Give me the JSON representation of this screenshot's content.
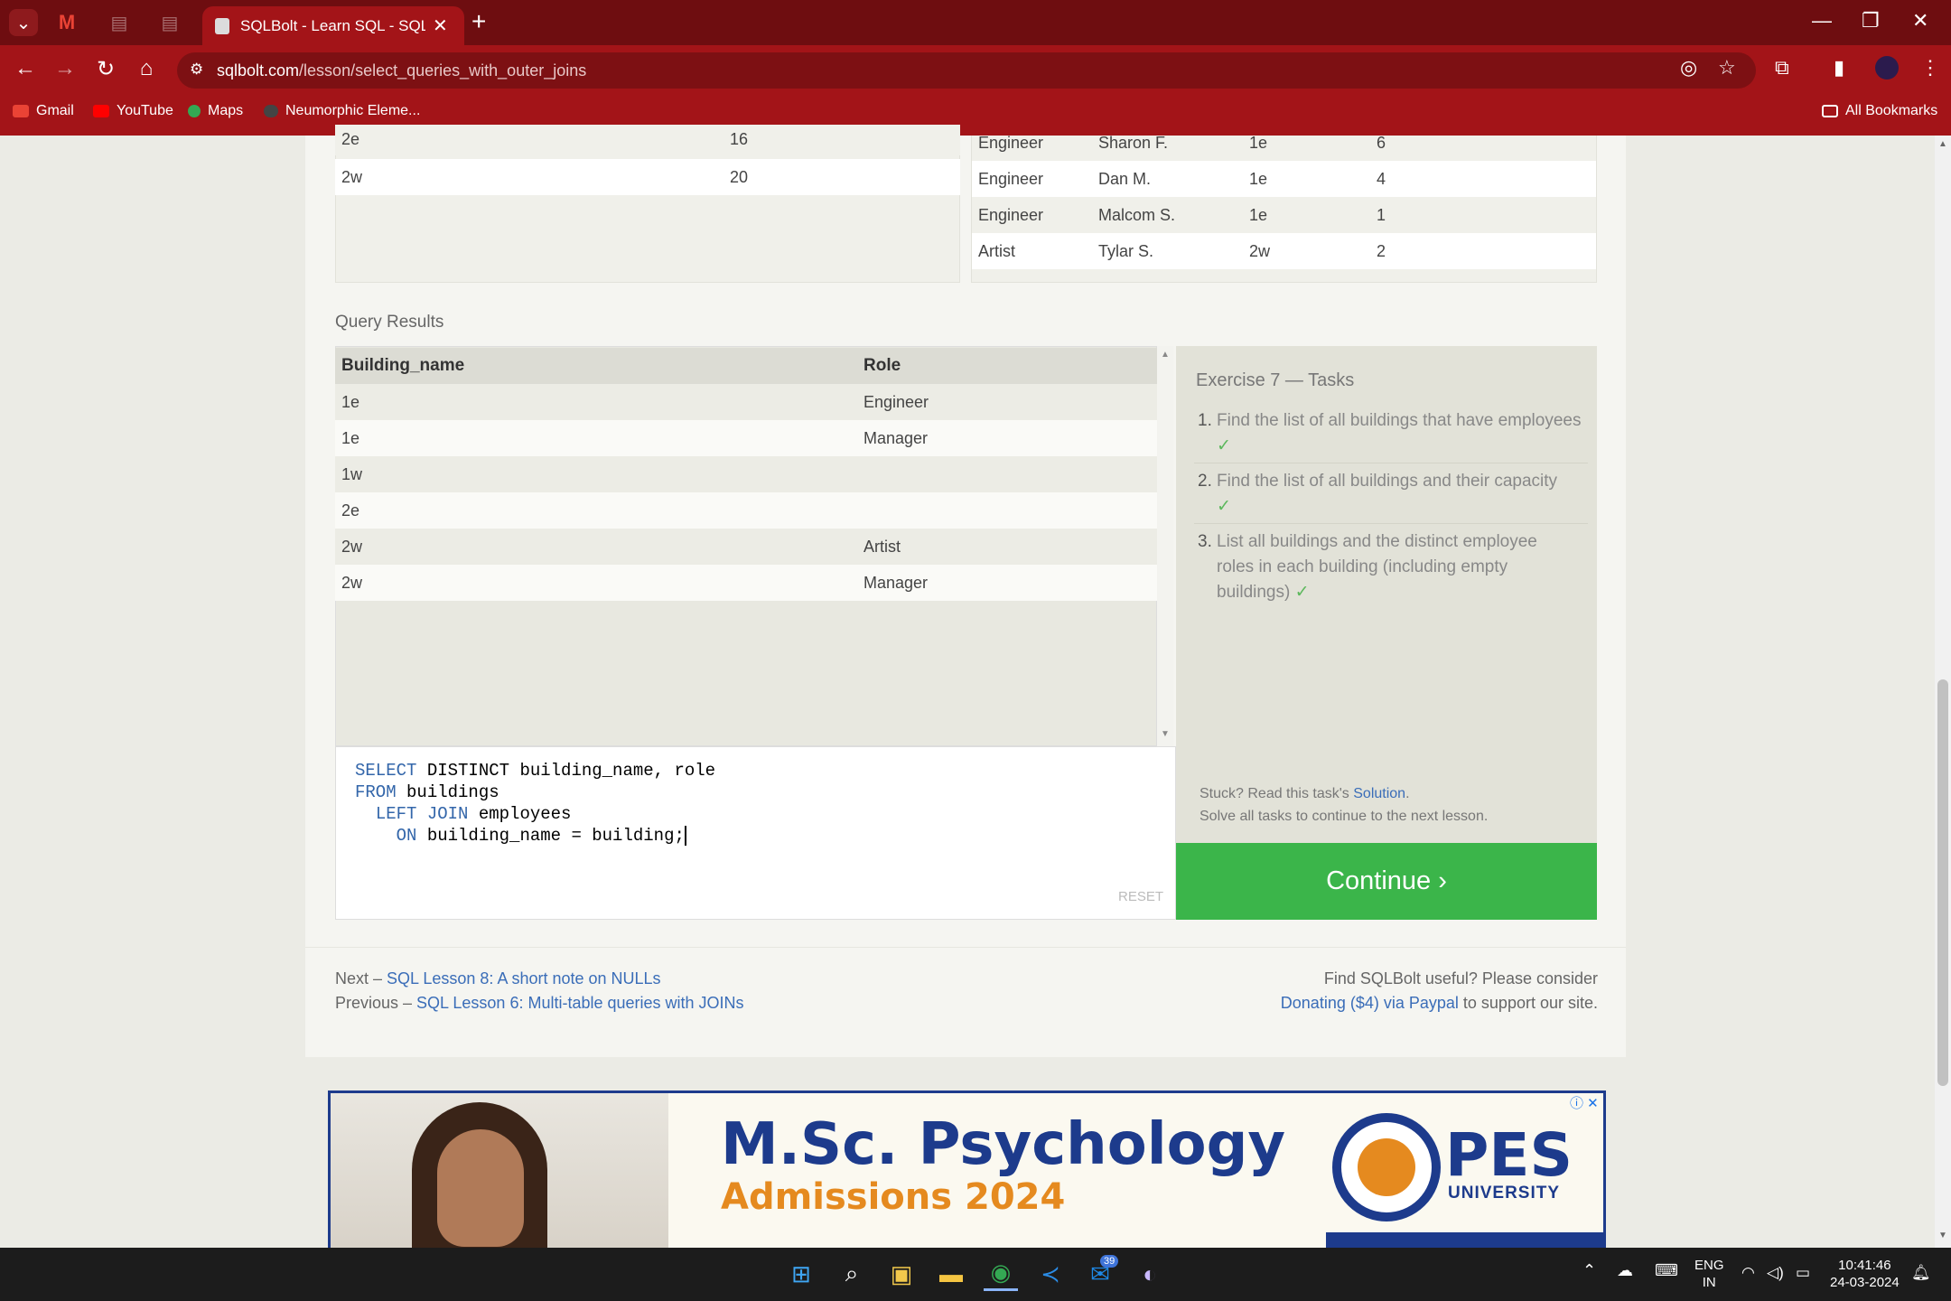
{
  "browser": {
    "tab_title": "SQLBolt - Learn SQL - SQL Less",
    "url_host": "sqlbolt.com",
    "url_path": "/lesson/select_queries_with_outer_joins",
    "bookmarks": [
      {
        "label": "Gmail"
      },
      {
        "label": "YouTube"
      },
      {
        "label": "Maps"
      },
      {
        "label": "Neumorphic Eleme..."
      }
    ],
    "all_bookmarks": "All Bookmarks"
  },
  "buildings_table": {
    "rows": [
      {
        "building": "2e",
        "capacity": "16"
      },
      {
        "building": "2w",
        "capacity": "20"
      }
    ]
  },
  "employees_table": {
    "rows": [
      {
        "role": "Engineer",
        "name": "Sharon F.",
        "building": "1e",
        "years": "6"
      },
      {
        "role": "Engineer",
        "name": "Dan M.",
        "building": "1e",
        "years": "4"
      },
      {
        "role": "Engineer",
        "name": "Malcom S.",
        "building": "1e",
        "years": "1"
      },
      {
        "role": "Artist",
        "name": "Tylar S.",
        "building": "2w",
        "years": "2"
      }
    ]
  },
  "query_results": {
    "label": "Query Results",
    "headers": [
      "Building_name",
      "Role"
    ],
    "rows": [
      {
        "building_name": "1e",
        "role": "Engineer"
      },
      {
        "building_name": "1e",
        "role": "Manager"
      },
      {
        "building_name": "1w",
        "role": ""
      },
      {
        "building_name": "2e",
        "role": ""
      },
      {
        "building_name": "2w",
        "role": "Artist"
      },
      {
        "building_name": "2w",
        "role": "Manager"
      }
    ]
  },
  "editor": {
    "line1_kw": "SELECT",
    "line1_rest": " DISTINCT building_name, role",
    "line2_kw": "FROM",
    "line2_rest": " buildings",
    "line3_kw": "LEFT JOIN",
    "line3_rest": " employees",
    "line4_kw": "ON",
    "line4_rest": " building_name = building;",
    "reset_label": "RESET"
  },
  "exercise": {
    "title": "Exercise 7 — Tasks",
    "tasks": [
      {
        "num": "1.",
        "text": "Find the list of all buildings that have employees",
        "check": "✓"
      },
      {
        "num": "2.",
        "text": "Find the list of all buildings and their capacity",
        "check": "✓"
      },
      {
        "num": "3.",
        "text": "List all buildings and the distinct employee roles in each building (including empty buildings)",
        "check": "✓"
      }
    ],
    "stuck_text": "Stuck? Read this task's ",
    "solution_link": "Solution",
    "stuck_end": ".",
    "solve_text": "Solve all tasks to continue to the next lesson.",
    "continue_label": "Continue ›"
  },
  "footer": {
    "next_prefix": "Next – ",
    "next_link": "SQL Lesson 8: A short note on NULLs",
    "prev_prefix": "Previous – ",
    "prev_link": "SQL Lesson 6: Multi-table queries with JOINs",
    "donate_line1": "Find SQLBolt useful? Please consider",
    "donate_link": "Donating ($4) via Paypal",
    "donate_end": " to support our site."
  },
  "ad": {
    "headline": "M.Sc. Psychology",
    "subline": "Admissions 2024",
    "brand": "PES",
    "brand_sub": "UNIVERSITY"
  },
  "taskbar": {
    "lang1": "ENG",
    "lang2": "IN",
    "time": "10:41:46",
    "date": "24-03-2024",
    "badge": "39"
  },
  "colors": {
    "tabbar": "#6e0d10",
    "toolbar": "#a31418",
    "continue": "#3bb54a",
    "link": "#3a6db8",
    "keyword": "#3366aa"
  }
}
